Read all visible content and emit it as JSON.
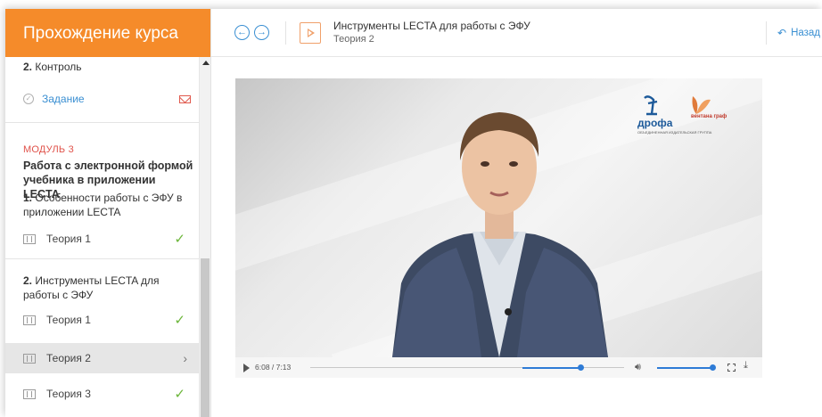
{
  "sidebar": {
    "header": "Прохождение курса",
    "control_section_num": "2.",
    "control_section": "Контроль",
    "task_label": "Задание",
    "module_label": "МОДУЛЬ 3",
    "module_title": "Работа с электронной формой учебника в приложении LECTA",
    "section1_num": "1.",
    "section1_title": "Особенности работы с ЭФУ в приложении LECTA",
    "section1_items": [
      {
        "label": "Теория 1"
      }
    ],
    "section2_num": "2.",
    "section2_title": "Инструменты LECTA для работы с ЭФУ",
    "section2_items": [
      {
        "label": "Теория 1"
      },
      {
        "label": "Теория 2"
      },
      {
        "label": "Теория 3"
      }
    ],
    "check_glyph": "✓",
    "chevron_glyph": "›"
  },
  "topbar": {
    "prev_glyph": "←",
    "next_glyph": "→",
    "lesson_title": "Инструменты LECTA для работы с ЭФУ",
    "lesson_subtitle": "Теория 2",
    "back_label": "Назад"
  },
  "video": {
    "logo_name": "дрофа",
    "logo_partner": "вентана граф",
    "logo_caption": "ОБЪЕДИНЕННАЯ ИЗДАТЕЛЬСКАЯ ГРУППА",
    "time": "6:08 / 7:13",
    "progress": 0.86,
    "volume": 1.0
  },
  "colors": {
    "accent_orange": "#f58b2a",
    "link_blue": "#3a8fd2",
    "check_green": "#6cb63a",
    "module_red": "#e0524a"
  }
}
